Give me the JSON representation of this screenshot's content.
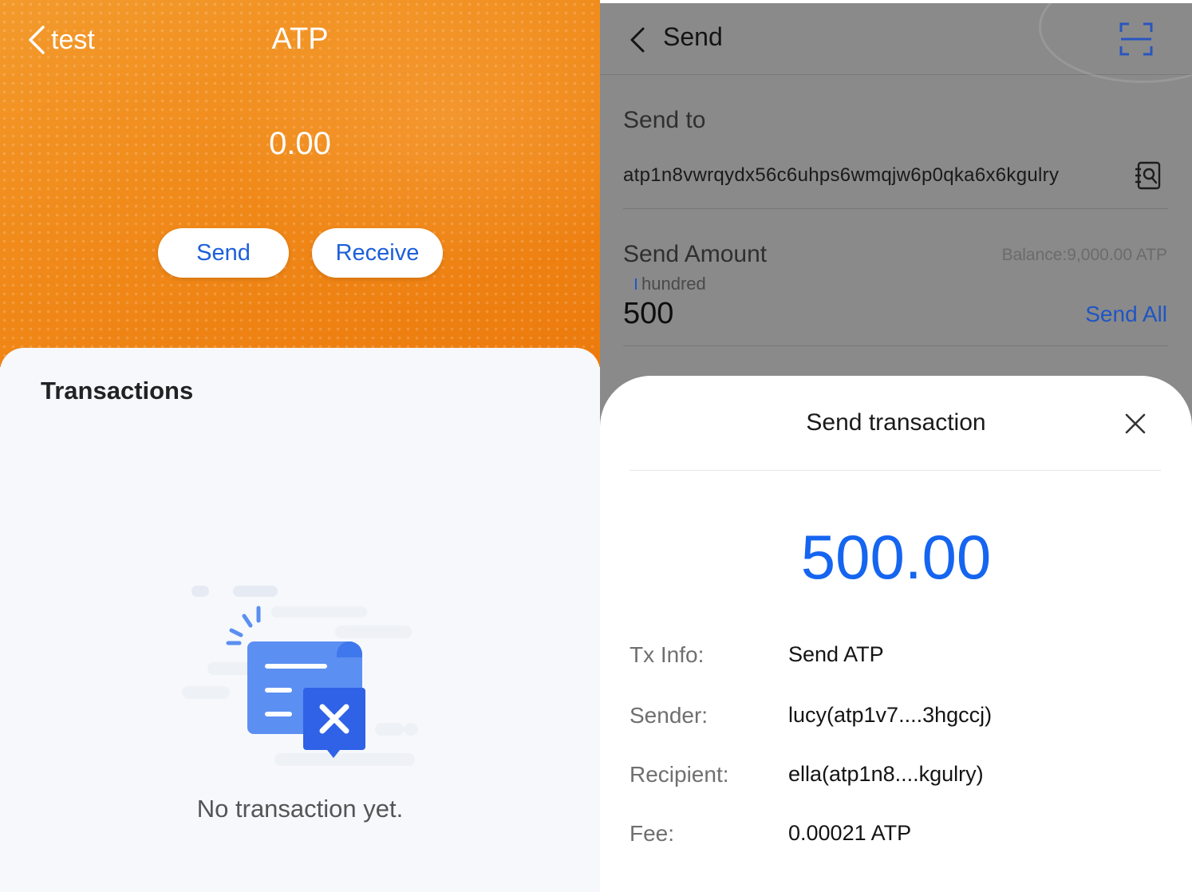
{
  "left": {
    "back_label": "test",
    "title": "ATP",
    "balance": "0.00",
    "send_label": "Send",
    "receive_label": "Receive",
    "transactions_heading": "Transactions",
    "empty_text": "No transaction yet.",
    "accent_color": "#f08a1a",
    "button_text_color": "#1e5fd9"
  },
  "right": {
    "nav_title": "Send",
    "send_to_label": "Send to",
    "address": "atp1n8vwrqydx56c6uhps6wmqjw6p0qka6x6kgulry",
    "send_amount_label": "Send Amount",
    "balance_note": "Balance:9,000.00 ATP",
    "unit_hint": "hundred",
    "amount_value": "500",
    "send_all_label": "Send All",
    "sheet": {
      "title": "Send transaction",
      "amount": "500.00",
      "amount_color": "#1565f0",
      "rows": [
        {
          "key": "Tx Info:",
          "value": "Send ATP"
        },
        {
          "key": "Sender:",
          "value": "lucy(atp1v7....3hgccj)"
        },
        {
          "key": "Recipient:",
          "value": "ella(atp1n8....kgulry)"
        },
        {
          "key": "Fee:",
          "value": "0.00021 ATP"
        }
      ]
    }
  }
}
